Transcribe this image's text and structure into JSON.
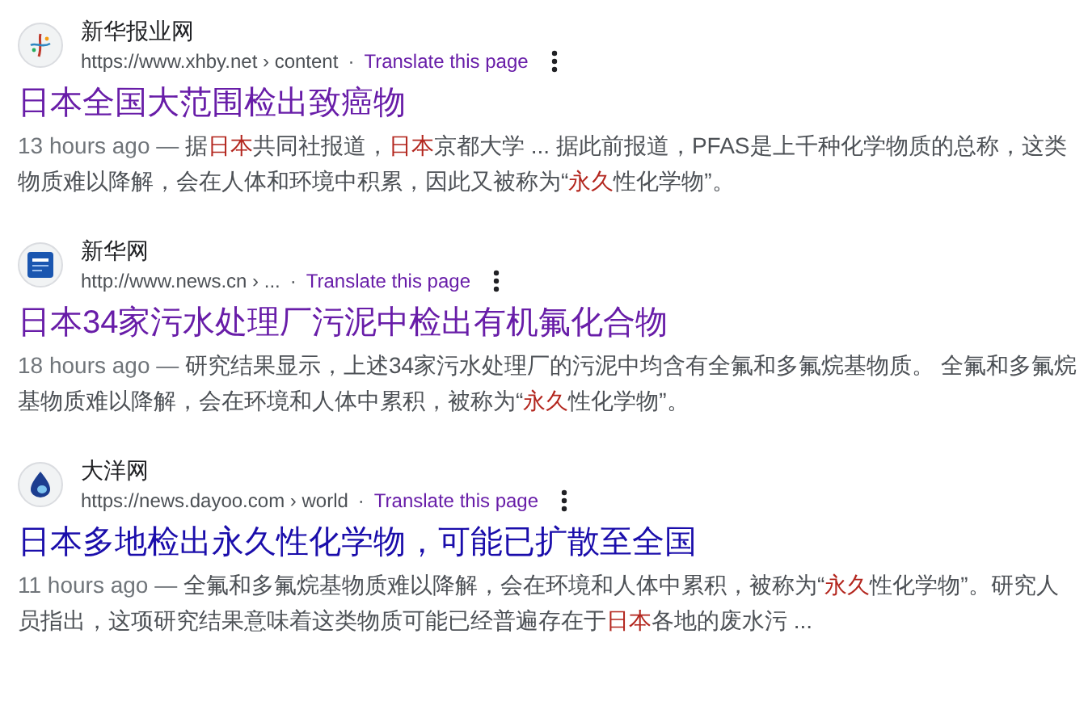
{
  "results": [
    {
      "site": "新华报业网",
      "url": "https://www.xhby.net › content",
      "separator": "·",
      "translate": "Translate this page",
      "title": "日本全国大范围检出致癌物",
      "visited": true,
      "kind": "feather",
      "date": "13 hours ago — ",
      "snippet": [
        {
          "text": "据",
          "highlighted": false
        },
        {
          "text": "日本",
          "highlighted": true
        },
        {
          "text": "共同社报道，",
          "highlighted": false
        },
        {
          "text": "日本",
          "highlighted": true
        },
        {
          "text": "京都大学 ... 据此前报道，PFAS是上千种化学物质的总称，这类物质难以降解，会在人体和环境中积累，因此又被称为“",
          "highlighted": false
        },
        {
          "text": "永久",
          "highlighted": true
        },
        {
          "text": "性化学物”。",
          "highlighted": false
        }
      ]
    },
    {
      "site": "新华网",
      "url": "http://www.news.cn › ...",
      "separator": "·",
      "translate": "Translate this page",
      "title": "日本34家污水处理厂污泥中检出有机氟化合物",
      "visited": true,
      "kind": "newspaper",
      "date": "18 hours ago — ",
      "snippet": [
        {
          "text": "研究结果显示，上述34家污水处理厂的污泥中均含有全氟和多氟烷基物质。 全氟和多氟烷基物质难以降解，会在环境和人体中累积，被称为“",
          "highlighted": false
        },
        {
          "text": "永久",
          "highlighted": true
        },
        {
          "text": "性化学物”。",
          "highlighted": false
        }
      ]
    },
    {
      "site": "大洋网",
      "url": "https://news.dayoo.com › world",
      "separator": "·",
      "translate": "Translate this page",
      "title": "日本多地检出永久性化学物，可能已扩散至全国",
      "visited": false,
      "kind": "drop",
      "date": "11 hours ago — ",
      "snippet": [
        {
          "text": "全氟和多氟烷基物质难以降解，会在环境和人体中累积，被称为“",
          "highlighted": false
        },
        {
          "text": "永久",
          "highlighted": true
        },
        {
          "text": "性化学物”。研究人员指出，这项研究结果意味着这类物质可能已经普遍存在于",
          "highlighted": false
        },
        {
          "text": "日本",
          "highlighted": true
        },
        {
          "text": "各地的废水污 ...",
          "highlighted": false
        }
      ]
    }
  ]
}
